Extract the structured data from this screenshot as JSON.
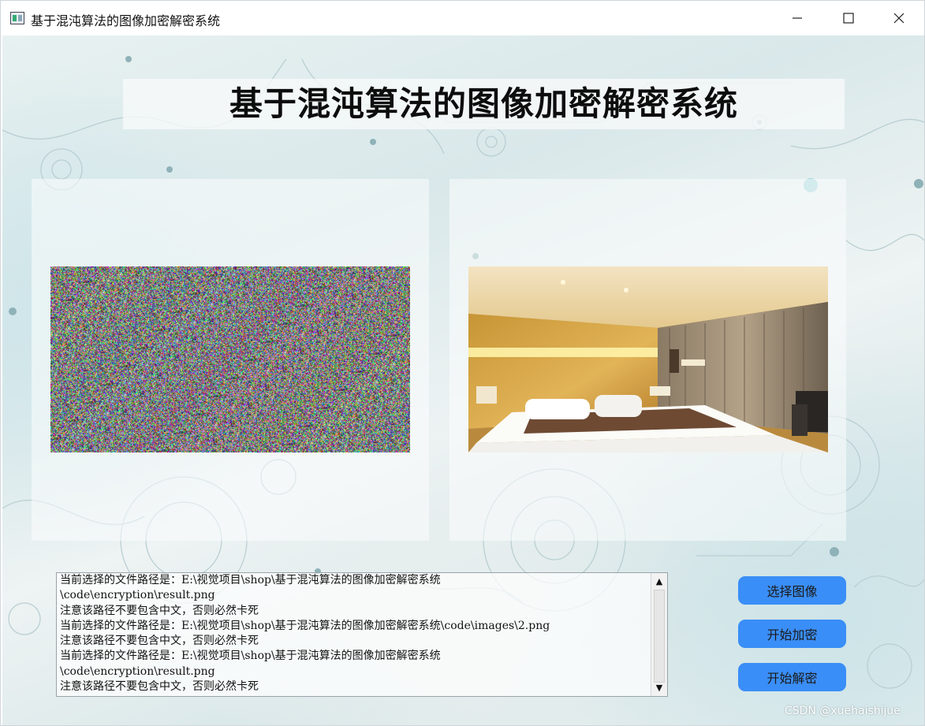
{
  "window": {
    "title": "基于混沌算法的图像加密解密系统"
  },
  "heading": "基于混沌算法的图像加密解密系统",
  "log": {
    "lines": [
      "当前选择的文件路径是：E:\\视觉项目\\shop\\基于混沌算法的图像加密解密系统",
      "\\code\\encryption\\result.png",
      "注意该路径不要包含中文，否则必然卡死",
      "当前选择的文件路径是：E:\\视觉项目\\shop\\基于混沌算法的图像加密解密系统\\code\\images\\2.png",
      "注意该路径不要包含中文，否则必然卡死",
      "当前选择的文件路径是：E:\\视觉项目\\shop\\基于混沌算法的图像加密解密系统",
      "\\code\\encryption\\result.png",
      "注意该路径不要包含中文，否则必然卡死"
    ]
  },
  "buttons": {
    "select_image": "选择图像",
    "start_encrypt": "开始加密",
    "start_decrypt": "开始解密"
  },
  "watermark": "CSDN @xuehaishijue",
  "icons": {
    "app": "app-window-icon",
    "minimize": "minimize-icon",
    "maximize": "maximize-icon",
    "close": "close-icon",
    "scroll_up": "arrow-up-icon",
    "scroll_down": "arrow-down-icon"
  },
  "colors": {
    "button_bg": "#3a8ef7",
    "titlebar_bg": "#ffffff"
  }
}
